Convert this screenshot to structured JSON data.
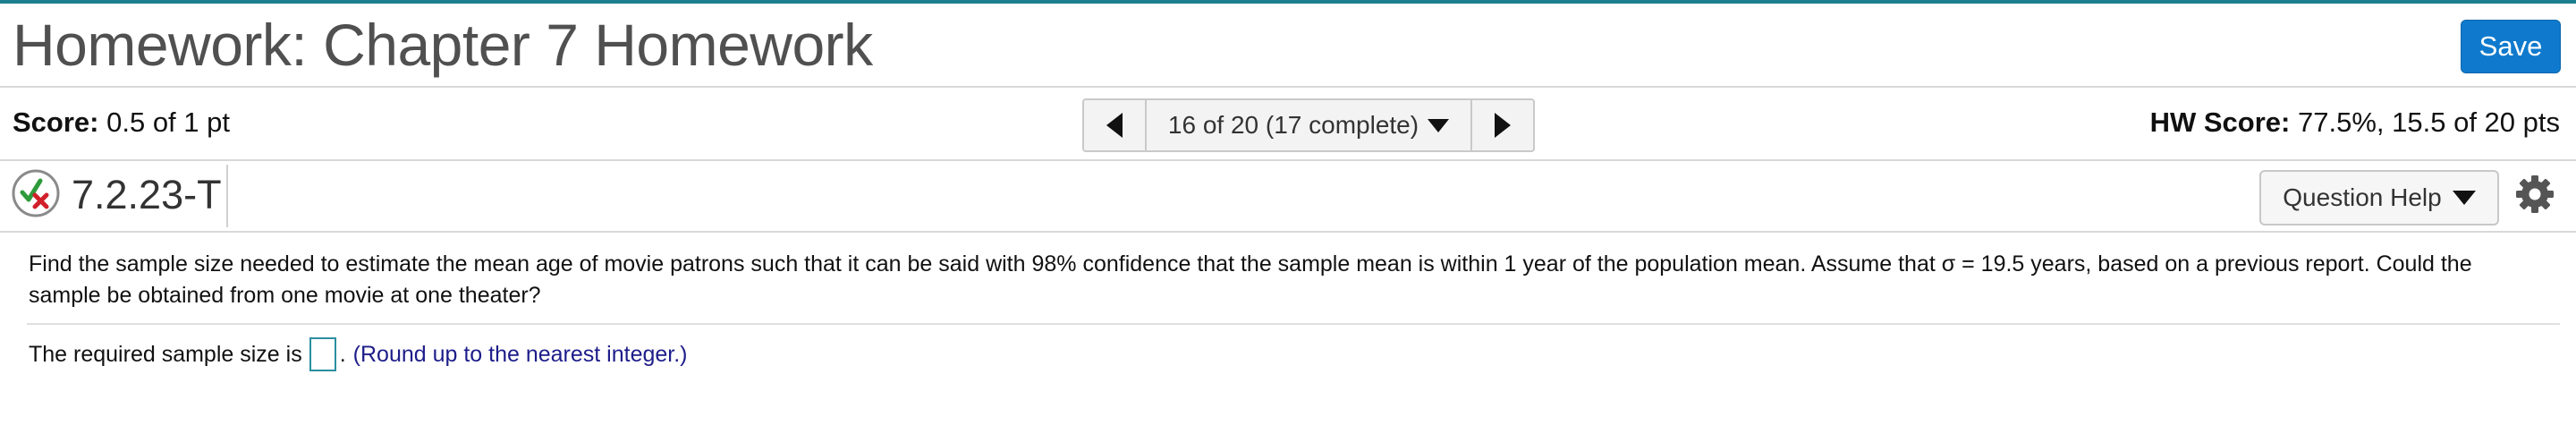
{
  "header": {
    "title": "Homework: Chapter 7 Homework",
    "save_label": "Save"
  },
  "scorebar": {
    "score_label": "Score:",
    "score_value": "0.5 of 1 pt",
    "nav_position": "16 of 20 (17 complete)",
    "hw_score_label": "HW Score:",
    "hw_score_value": "77.5%, 15.5 of 20 pts"
  },
  "question": {
    "id": "7.2.23-T",
    "status_icon": "partially-correct-icon",
    "help_label": "Question Help",
    "text": "Find the sample size needed to estimate the mean age of movie patrons such that it can be said with 98% confidence that the sample mean is within 1 year of the population mean. Assume that σ = 19.5 years, based on a previous report. Could the sample be obtained from one movie at one theater?",
    "answer_prefix": "The required sample size is",
    "answer_value": "",
    "answer_suffix": ".",
    "answer_hint": "(Round up to the nearest integer.)"
  },
  "colors": {
    "accent": "#0f7acd",
    "top_line": "#1b7f8f",
    "hint_text": "#1d1d8a",
    "correct_check": "#2e9b3a",
    "incorrect_x": "#d0202a"
  }
}
